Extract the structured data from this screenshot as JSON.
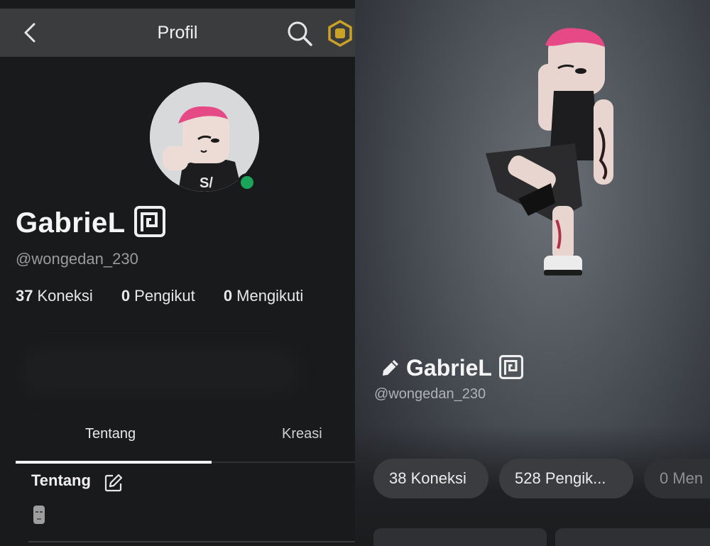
{
  "left": {
    "header": {
      "title": "Profil",
      "back_icon": "chevron-left-icon",
      "search_icon": "search-icon",
      "robux_icon": "robux-icon"
    },
    "profile": {
      "display_name": "GabrieL",
      "verified_icon": "premium-badge-icon",
      "username": "@wongedan_230",
      "online": true,
      "stats": [
        {
          "value": "37",
          "label": "Koneksi"
        },
        {
          "value": "0",
          "label": "Pengikut"
        },
        {
          "value": "0",
          "label": "Mengikuti"
        }
      ]
    },
    "tabs": [
      {
        "label": "Tentang",
        "active": true
      },
      {
        "label": "Kreasi",
        "active": false
      }
    ],
    "about": {
      "title": "Tentang",
      "edit_icon": "edit-icon",
      "emoji_icon": "moai-icon"
    }
  },
  "right": {
    "display_name": "GabrieL",
    "edit_icon": "pencil-icon",
    "verified_icon": "premium-badge-icon",
    "username": "@wongedan_230",
    "pills": [
      "38 Koneksi",
      "528 Pengik...",
      "0 Men"
    ]
  },
  "colors": {
    "online": "#1aa55a",
    "robux_gold": "#c9a227",
    "panel_bg": "#191a1c",
    "header_bg": "#3b3c3e"
  }
}
